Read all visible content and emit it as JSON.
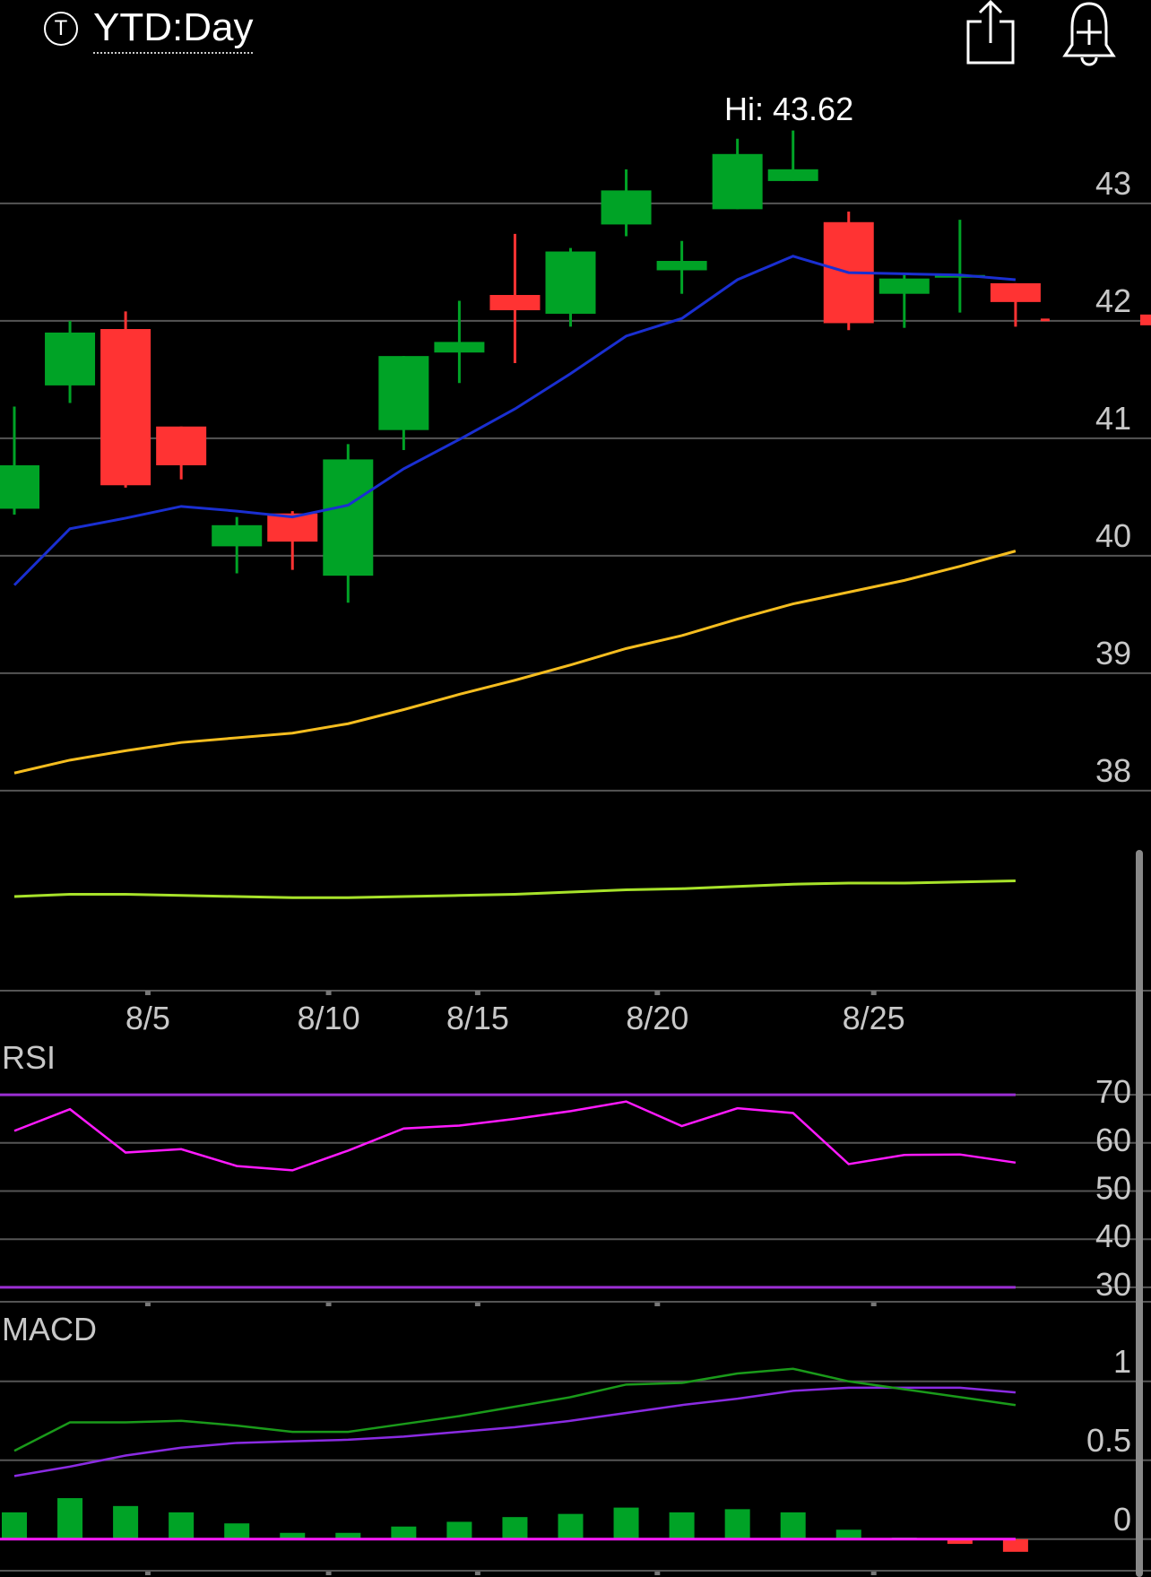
{
  "header": {
    "ticker_badge": "T",
    "period_label": "YTD:Day",
    "share_icon": "share-icon",
    "alert_icon": "alert-plus-bell-icon"
  },
  "colors": {
    "up": "#00a326",
    "down": "#ff3333",
    "ma_fast": "#1a2fd1",
    "ma_slow": "#f5bd1f",
    "volume_line": "#a7e22a",
    "rsi_line": "#ff1aff",
    "rsi_bands": "#9b2fd3",
    "macd_line": "#1a9a1a",
    "signal_line": "#8a2be2",
    "macd_zero": "#ff1aff",
    "grid": "#555555"
  },
  "chart_data": {
    "type": "candlestick",
    "hi_annotation": "Hi: 43.62",
    "last_price_marker": 42,
    "x_ticks": [
      "8/5",
      "8/10",
      "8/15",
      "8/20",
      "8/25"
    ],
    "price_axis": {
      "ticks": [
        "43",
        "42",
        "41",
        "40",
        "39",
        "38"
      ],
      "ylim": [
        37.9,
        43.8
      ]
    },
    "candles": [
      {
        "open": 40.4,
        "high": 41.27,
        "low": 40.35,
        "close": 40.77
      },
      {
        "open": 41.45,
        "high": 42.0,
        "low": 41.3,
        "close": 41.9
      },
      {
        "open": 41.93,
        "high": 42.08,
        "low": 40.58,
        "close": 40.6
      },
      {
        "open": 41.1,
        "high": 41.1,
        "low": 40.65,
        "close": 40.77
      },
      {
        "open": 40.08,
        "high": 40.33,
        "low": 39.85,
        "close": 40.26
      },
      {
        "open": 40.36,
        "high": 40.38,
        "low": 39.88,
        "close": 40.12
      },
      {
        "open": 39.83,
        "high": 40.95,
        "low": 39.6,
        "close": 40.82
      },
      {
        "open": 41.07,
        "high": 41.7,
        "low": 40.9,
        "close": 41.7
      },
      {
        "open": 41.73,
        "high": 42.17,
        "low": 41.47,
        "close": 41.82
      },
      {
        "open": 42.22,
        "high": 42.74,
        "low": 41.64,
        "close": 42.09
      },
      {
        "open": 42.06,
        "high": 42.62,
        "low": 41.95,
        "close": 42.59
      },
      {
        "open": 42.82,
        "high": 43.29,
        "low": 42.72,
        "close": 43.11
      },
      {
        "open": 42.43,
        "high": 42.68,
        "low": 42.23,
        "close": 42.51
      },
      {
        "open": 42.95,
        "high": 43.55,
        "low": 42.95,
        "close": 43.42
      },
      {
        "open": 43.19,
        "high": 43.62,
        "low": 43.19,
        "close": 43.29
      },
      {
        "open": 42.84,
        "high": 42.93,
        "low": 41.92,
        "close": 41.98
      },
      {
        "open": 42.23,
        "high": 42.41,
        "low": 41.94,
        "close": 42.36
      },
      {
        "open": 42.37,
        "high": 42.86,
        "low": 42.07,
        "close": 42.39
      },
      {
        "open": 42.32,
        "high": 42.32,
        "low": 41.95,
        "close": 42.16
      }
    ],
    "ma_fast": [
      39.75,
      40.23,
      40.32,
      40.42,
      40.38,
      40.33,
      40.43,
      40.74,
      40.99,
      41.25,
      41.55,
      41.87,
      42.02,
      42.35,
      42.55,
      42.41,
      42.4,
      42.39,
      42.35
    ],
    "ma_slow": [
      38.15,
      38.26,
      38.34,
      38.41,
      38.45,
      38.49,
      38.57,
      38.69,
      38.82,
      38.94,
      39.07,
      39.21,
      39.32,
      39.46,
      39.59,
      39.69,
      39.79,
      39.91,
      40.04
    ],
    "volume_line": [
      0.4,
      0.41,
      0.41,
      0.405,
      0.4,
      0.395,
      0.395,
      0.4,
      0.405,
      0.41,
      0.42,
      0.43,
      0.435,
      0.445,
      0.455,
      0.46,
      0.46,
      0.465,
      0.47
    ],
    "rsi": {
      "label": "RSI",
      "ticks": [
        "70",
        "60",
        "50",
        "40",
        "30"
      ],
      "ylim": [
        27,
        73
      ],
      "bands": [
        70,
        30
      ],
      "values": [
        62.5,
        67,
        58,
        58.7,
        55.2,
        54.3,
        58.4,
        63,
        63.6,
        65,
        66.6,
        68.6,
        63.5,
        67.2,
        66.2,
        55.6,
        57.5,
        57.6,
        55.9
      ]
    },
    "macd": {
      "label": "MACD",
      "ticks": [
        "1",
        "0.5",
        "0"
      ],
      "ylim": [
        -0.2,
        1.3
      ],
      "macd": [
        0.56,
        0.74,
        0.74,
        0.75,
        0.72,
        0.68,
        0.68,
        0.73,
        0.78,
        0.84,
        0.9,
        0.98,
        0.99,
        1.05,
        1.08,
        1.0,
        0.95,
        0.9,
        0.85
      ],
      "signal": [
        0.4,
        0.46,
        0.53,
        0.58,
        0.61,
        0.62,
        0.63,
        0.65,
        0.68,
        0.71,
        0.75,
        0.8,
        0.85,
        0.89,
        0.94,
        0.96,
        0.96,
        0.96,
        0.93
      ],
      "histogram": [
        0.17,
        0.26,
        0.21,
        0.17,
        0.1,
        0.04,
        0.04,
        0.08,
        0.11,
        0.14,
        0.16,
        0.2,
        0.17,
        0.19,
        0.17,
        0.06,
        0.01,
        -0.03,
        -0.08
      ]
    }
  }
}
